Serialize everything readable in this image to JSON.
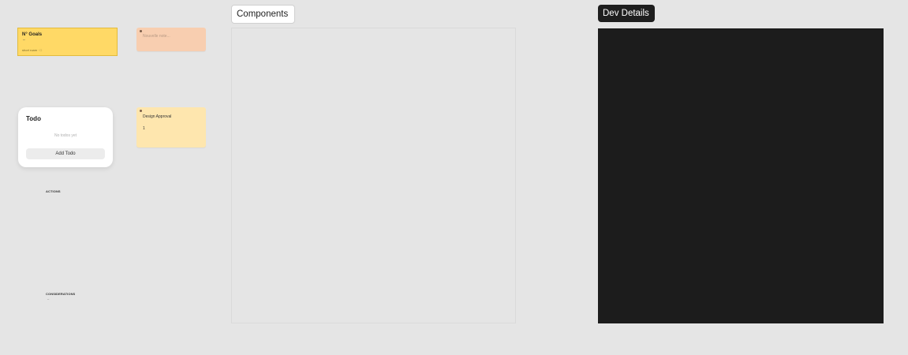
{
  "goals": {
    "title": "N° Goals",
    "dash": "–",
    "footer": "short roam · □"
  },
  "note_peach": {
    "placeholder": "Nouvelle note..."
  },
  "note_yellow": {
    "title": "Design Approval",
    "number": "1"
  },
  "todo": {
    "title": "Todo",
    "empty": "No todos yet",
    "add_label": "Add Todo"
  },
  "sections": {
    "actions": "ACTIONS",
    "considerations": "CONSIDERATIONS",
    "considerations_mark": "–"
  },
  "frames": {
    "components": "Components",
    "dev_details": "Dev Details"
  },
  "colors": {
    "canvas": "#e5e5e5",
    "goals_sticky": "#ffd966",
    "peach_note": "#f8ceb0",
    "yellow_note": "#fee6ae",
    "dev_frame": "#1c1c1c"
  }
}
